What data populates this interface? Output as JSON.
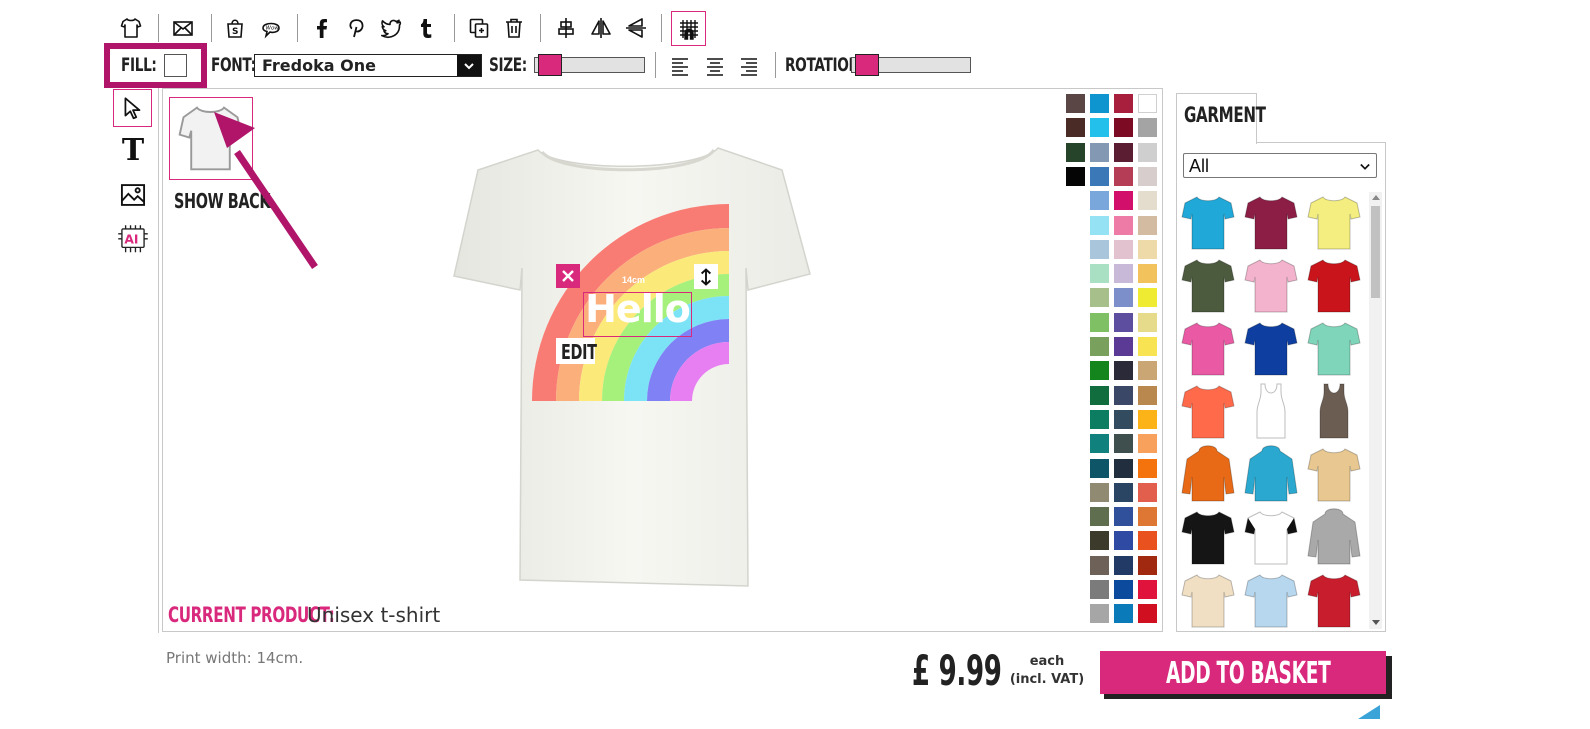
{
  "toolbar": {
    "fill_label": "FILL:",
    "font_label": "FONT:",
    "font_value": "Fredoka One",
    "size_label": "SIZE:",
    "rotation_label": "ROTATION:",
    "size_level_percent": 3,
    "rotation_level_percent": 3
  },
  "canvas": {
    "show_back_label": "SHOW BACK",
    "design_text": "Hello",
    "dimension_label": "14cm",
    "edit_label": "EDIT",
    "current_product_label": "CURRENT PRODUCT:",
    "current_product_value": "Unisex t-shirt"
  },
  "print_width": "Print width: 14cm.",
  "garment_panel": {
    "tab_label": "GARMENT",
    "filter_value": "All",
    "filter_options": [
      "All"
    ]
  },
  "price": {
    "amount": "£ 9.99",
    "each": "each",
    "vat": "(incl. VAT)"
  },
  "basket_button": "ADD TO BASKET",
  "colors": {
    "accent": "#d9297c",
    "annotation": "#b0156a",
    "swatches": [
      [
        "#5b4646",
        "#0e95cf",
        "#a71f3c",
        "#ffffff"
      ],
      [
        "#4a2b26",
        "#23c0ec",
        "#7b0a22",
        "#a4a4a4"
      ],
      [
        "#25442a",
        "#8399b3",
        "#5a1d32",
        "#cfcfcf"
      ],
      [
        "#050505",
        "#3b78b7",
        "#b53d56",
        "#d8cdcd"
      ],
      [
        "",
        "#79a7db",
        "#d2106c",
        "#e4dccd"
      ],
      [
        "",
        "#94e2f4",
        "#ee7aa6",
        "#d2bba0"
      ],
      [
        "",
        "#a9c5dc",
        "#e3c2cf",
        "#eed9a8"
      ],
      [
        "",
        "#a9dfc2",
        "#c8b9d8",
        "#f2c35c"
      ],
      [
        "",
        "#a7bf8b",
        "#7d8fcb",
        "#eeeb32"
      ],
      [
        "",
        "#7ec063",
        "#5e4ea0",
        "#e6db8a"
      ],
      [
        "",
        "#79a05c",
        "#5b3a96",
        "#f8e453"
      ],
      [
        "",
        "#14851d",
        "#2b2a39",
        "#c9a673"
      ],
      [
        "",
        "#116d3e",
        "#3a4766",
        "#b9884e"
      ],
      [
        "",
        "#0c7d61",
        "#334b5e",
        "#fbb318"
      ],
      [
        "",
        "#10817d",
        "#3f4f4e",
        "#f8a15d"
      ],
      [
        "",
        "#0f5568",
        "#202e3d",
        "#f4730d"
      ],
      [
        "",
        "#918a72",
        "#2a4464",
        "#e15f4c"
      ],
      [
        "",
        "#5e6e4f",
        "#31509b",
        "#de7734"
      ],
      [
        "",
        "#3c3a2b",
        "#2e4aa2",
        "#e9511f"
      ],
      [
        "",
        "#6e6258",
        "#213a66",
        "#a1290f"
      ],
      [
        "",
        "#7b7b7b",
        "#0b4a9c",
        "#e0133c"
      ],
      [
        "",
        "#a6a6a6",
        "#0a7ab8",
        "#d01021"
      ]
    ],
    "garments": [
      [
        "#1fa8d8",
        "#8c1e46",
        "#f3ee7f"
      ],
      [
        "#4c5a3e",
        "#f4b3cc",
        "#c8141a"
      ],
      [
        "#ea5aa4",
        "#0e3fa0",
        "#7fd5b9"
      ],
      [
        "#ff6a4a",
        "#ffffff",
        "#6b5d52"
      ],
      [
        "#e86a16",
        "#2aa8cf",
        "#e8c890"
      ],
      [
        "#151515",
        "#ffffff",
        "#a9a9a9"
      ],
      [
        "#f1dfc4",
        "#b7d7ee",
        "#c81d2c"
      ]
    ]
  },
  "icons": [
    "tshirt-icon",
    "envelope-icon",
    "shop-bag-icon",
    "wow-bubble-icon",
    "facebook-icon",
    "pinterest-icon",
    "twitter-icon",
    "tumblr-icon",
    "duplicate-icon",
    "trash-icon",
    "align-center-vertical-icon",
    "flip-horizontal-icon",
    "flip-vertical-icon",
    "grid-snap-icon",
    "pointer-icon",
    "text-tool-icon",
    "image-tool-icon",
    "ai-tool-icon",
    "close-icon",
    "resize-vertical-icon"
  ]
}
